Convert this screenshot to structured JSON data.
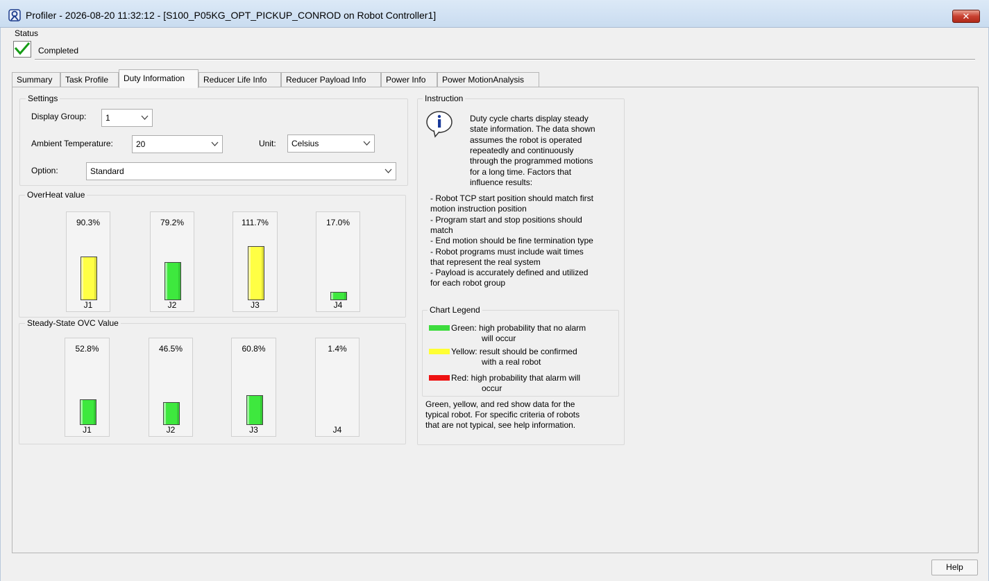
{
  "window": {
    "title": "Profiler - 2026-08-20 11:32:12 - [S100_P05KG_OPT_PICKUP_CONROD on Robot Controller1]",
    "close_label": "✕"
  },
  "status": {
    "label": "Status",
    "text": "Completed"
  },
  "tabs": [
    {
      "label": "Summary"
    },
    {
      "label": "Task Profile"
    },
    {
      "label": "Duty Information"
    },
    {
      "label": "Reducer Life Info"
    },
    {
      "label": "Reducer Payload Info"
    },
    {
      "label": "Power Info"
    },
    {
      "label": "Power MotionAnalysis"
    }
  ],
  "active_tab": "Duty Information",
  "settings": {
    "title": "Settings",
    "display_group_label": "Display Group:",
    "display_group_value": "1",
    "ambient_temp_label": "Ambient Temperature:",
    "ambient_temp_value": "20",
    "unit_label": "Unit:",
    "unit_value": "Celsius",
    "option_label": "Option:",
    "option_value": "Standard"
  },
  "overheat": {
    "title": "OverHeat value",
    "bars": [
      {
        "label": "J1",
        "pct": "90.3%",
        "value": 90.3,
        "color": "yellow"
      },
      {
        "label": "J2",
        "pct": "79.2%",
        "value": 79.2,
        "color": "green"
      },
      {
        "label": "J3",
        "pct": "111.7%",
        "value": 111.7,
        "color": "yellow"
      },
      {
        "label": "J4",
        "pct": "17.0%",
        "value": 17.0,
        "color": "green"
      }
    ]
  },
  "ovc": {
    "title": "Steady-State OVC Value",
    "bars": [
      {
        "label": "J1",
        "pct": "52.8%",
        "value": 52.8,
        "color": "green"
      },
      {
        "label": "J2",
        "pct": "46.5%",
        "value": 46.5,
        "color": "green"
      },
      {
        "label": "J3",
        "pct": "60.8%",
        "value": 60.8,
        "color": "green"
      },
      {
        "label": "J4",
        "pct": "1.4%",
        "value": 1.4,
        "color": "green"
      }
    ]
  },
  "instruction": {
    "title": "Instruction",
    "intro": [
      "Duty cycle charts display steady",
      "state information. The data shown",
      "assumes the robot is operated",
      "repeatedly and continuously",
      "through the programmed motions",
      "for a long time. Factors that",
      "influence results:"
    ],
    "factors": [
      "- Robot TCP start position should match first",
      "motion instruction position",
      "- Program start and stop positions should",
      "match",
      "- End motion should be fine termination type",
      "- Robot programs must include wait times",
      "that represent the real system",
      "- Payload is accurately defined and utilized",
      "for each robot group"
    ],
    "legend_title": "Chart Legend",
    "legend": [
      {
        "line1": "Green: high probability that no alarm",
        "line2": "will occur",
        "color": "#3ddc3d"
      },
      {
        "line1": "Yellow: result should be confirmed",
        "line2": "with a real robot",
        "color": "#ffff33"
      },
      {
        "line1": "Red: high probability that alarm will",
        "line2": "occur",
        "color": "#ee1111"
      }
    ],
    "footer": [
      "Green, yellow, and red show data for the",
      "typical robot. For specific criteria of robots",
      "that are not typical, see help information."
    ]
  },
  "help_label": "Help",
  "colors": {
    "green": "#3ee83e",
    "yellow": "#ffff44",
    "red": "#ee1111"
  }
}
